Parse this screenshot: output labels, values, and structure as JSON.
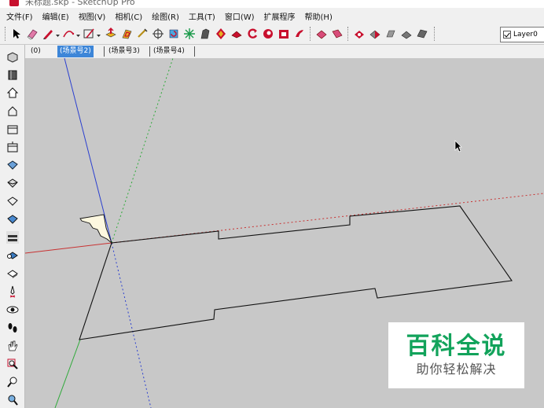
{
  "window": {
    "title": "未标题.skp - SketchUp Pro"
  },
  "menubar": {
    "items": [
      {
        "label": "文件(F)",
        "name": "menu-file"
      },
      {
        "label": "编辑(E)",
        "name": "menu-edit"
      },
      {
        "label": "视图(V)",
        "name": "menu-view"
      },
      {
        "label": "相机(C)",
        "name": "menu-camera"
      },
      {
        "label": "绘图(R)",
        "name": "menu-draw"
      },
      {
        "label": "工具(T)",
        "name": "menu-tools"
      },
      {
        "label": "窗口(W)",
        "name": "menu-window"
      },
      {
        "label": "扩展程序",
        "name": "menu-extensions"
      },
      {
        "label": "帮助(H)",
        "name": "menu-help"
      }
    ]
  },
  "toolbar": {
    "tools": [
      "select-arrow-icon",
      "eraser-icon",
      "pencil-line-icon",
      "arc-icon",
      "rectangle-icon",
      "push-pull-icon",
      "offset-icon",
      "paint-bucket-icon",
      "move-icon",
      "rotate-icon",
      "scale-icon",
      "follow-me-icon",
      "flip-icon",
      "orbit-icon",
      "pan-icon",
      "zoom-icon",
      "warehouse-icon",
      "extension-icon",
      "solid-union-icon",
      "solid-subtract-icon",
      "solid-intersect-icon",
      "solid-trim-icon",
      "solid-split-icon"
    ],
    "layer": {
      "current": "Layer0"
    }
  },
  "lefttoolbar": {
    "tools": [
      "iso-view-icon",
      "top-view-icon",
      "front-view-icon",
      "right-view-icon",
      "back-view-icon",
      "left-view-icon",
      "bottom-view-icon",
      "xray-icon",
      "wireframe-icon",
      "hidden-line-icon",
      "shaded-icon",
      "textured-icon",
      "monochrome-icon",
      "position-camera-icon",
      "look-around-icon",
      "walk-icon",
      "hand-pan-icon",
      "zoom-window-icon",
      "zoom-extents-icon",
      "previous-view-icon"
    ]
  },
  "scenes": {
    "tabs": [
      {
        "label": "(0)",
        "active": false
      },
      {
        "label": "(场景号2)",
        "active": true
      },
      {
        "label": "(场景号3)",
        "active": false
      },
      {
        "label": "(场景号4)",
        "active": false
      }
    ]
  },
  "watermark": {
    "title": "百科全说",
    "subtitle": "助你轻松解决"
  },
  "colors": {
    "accent": "#3d86d8",
    "viewport_bg": "#c8c8c8",
    "axis_red": "#c83232",
    "axis_green": "#2faa3a",
    "axis_blue": "#2a3fcf",
    "watermark_green": "#12a35b"
  }
}
